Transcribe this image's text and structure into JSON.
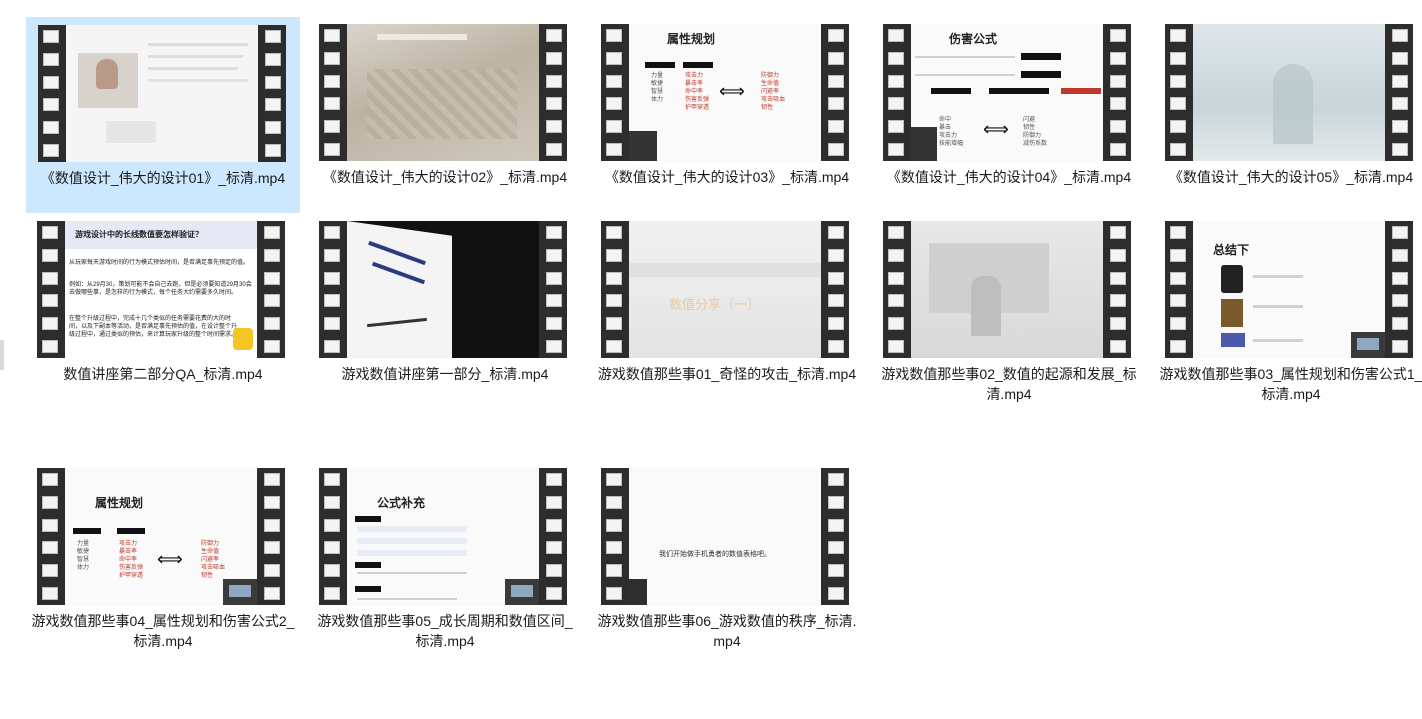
{
  "files": [
    {
      "name": "《数值设计_伟大的设计01》_标清.mp4",
      "selected": true
    },
    {
      "name": "《数值设计_伟大的设计02》_标清.mp4",
      "selected": false
    },
    {
      "name": "《数值设计_伟大的设计03》_标清.mp4",
      "selected": false
    },
    {
      "name": "《数值设计_伟大的设计04》_标清.mp4",
      "selected": false
    },
    {
      "name": "《数值设计_伟大的设计05》_标清.mp4",
      "selected": false
    },
    {
      "name": "数值讲座第二部分QA_标清.mp4",
      "selected": false
    },
    {
      "name": "游戏数值讲座第一部分_标清.mp4",
      "selected": false
    },
    {
      "name": "游戏数值那些事01_奇怪的攻击_标清.mp4",
      "selected": false
    },
    {
      "name": "游戏数值那些事02_数值的起源和发展_标清.mp4",
      "selected": false
    },
    {
      "name": "游戏数值那些事03_属性规划和伤害公式1_标清.mp4",
      "selected": false
    },
    {
      "name": "游戏数值那些事04_属性规划和伤害公式2_标清.mp4",
      "selected": false
    },
    {
      "name": "游戏数值那些事05_成长周期和数值区间_标清.mp4",
      "selected": false
    },
    {
      "name": "游戏数值那些事06_游戏数值的秩序_标清.mp4",
      "selected": false
    }
  ],
  "thumb_text": {
    "t3_title": "属性规划",
    "t4_title": "伤害公式",
    "t6_title": "游戏设计中的长线数值要怎样验证？",
    "t6_p1": "从玩家每天游戏时间的行为模式预估时间，是否满足事先预定的值。",
    "t6_p2": "例如：从29月30，策划可能不会自己去跑，但是必须要知道29月30会去做哪些事，是怎样的行为模式，每个任务大约需要多久时间。",
    "t6_p3": "在整个升级过程中，完成十几个类似的任务需要花费的大的时间，以及下副本等活动，是否满足事先预估的值，在设计整个升级过程中，通过类似的预估，来计算玩家升级的整个时间需求。",
    "t8_title": "数值分享（一）",
    "t10_title": "总结下",
    "t11_title": "属性规划",
    "t12_title": "公式补充",
    "t13_text": "我们开始做手机勇者的数值表格吧。"
  }
}
